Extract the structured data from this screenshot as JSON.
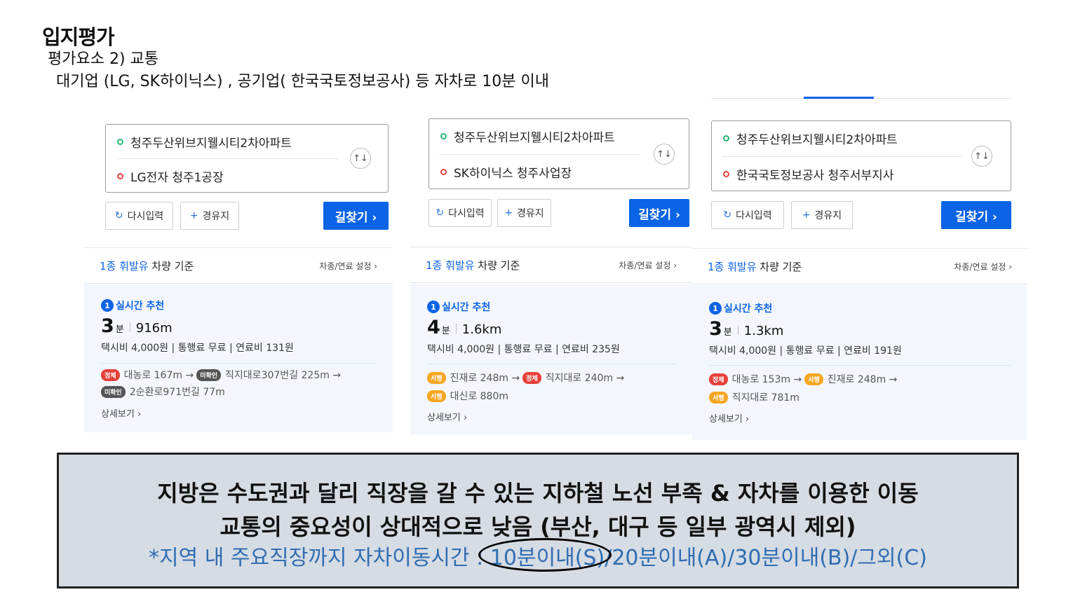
{
  "header": {
    "title": "입지평가",
    "subtitle": "평가요소 2) 교통",
    "summary": "대기업 (LG, SK하이닉스) , 공기업( 한국국토정보공사) 등 자차로 10분 이내"
  },
  "panels": [
    {
      "origin": "청주두산위브지웰시티2차아파트",
      "destination": "LG전자 청주1공장",
      "swap_icon": "↑↓",
      "reset_label": "다시입력",
      "waypoint_label": "경유지",
      "search_label": "길찾기 ›",
      "basis_prefix": "1종 휘발유",
      "basis_suffix": " 차량 기준",
      "settings_label": "차종/연료 설정 ›",
      "rec_num": "1",
      "rec_label": "실시간 추천",
      "time_value": "3",
      "time_unit": "분",
      "distance": "916m",
      "costs": "택시비 4,000원  |  통행료 무료  |  연료비 131원",
      "seg1": [
        {
          "tag": "정체",
          "color": "red",
          "text": "대농로 167m →"
        },
        {
          "tag": "미확인",
          "color": "dark",
          "text": "직지대로307번길 225m →"
        }
      ],
      "seg2": [
        {
          "tag": "미확인",
          "color": "dark",
          "text": "2순환로971번길 77m"
        }
      ],
      "detail_label": "상세보기 ›"
    },
    {
      "origin": "청주두산위브지웰시티2차아파트",
      "destination": "SK하이닉스 청주사업장",
      "swap_icon": "↑↓",
      "reset_label": "다시입력",
      "waypoint_label": "경유지",
      "search_label": "길찾기 ›",
      "basis_prefix": "1종 휘발유",
      "basis_suffix": " 차량 기준",
      "settings_label": "차종/연료 설정 ›",
      "rec_num": "1",
      "rec_label": "실시간 추천",
      "time_value": "4",
      "time_unit": "분",
      "distance": "1.6km",
      "costs": "택시비 4,000원  |  통행료 무료  |  연료비 235원",
      "seg1": [
        {
          "tag": "서행",
          "color": "orange",
          "text": "진재로 248m →"
        },
        {
          "tag": "정체",
          "color": "red",
          "text": "직지대로 240m →"
        }
      ],
      "seg2": [
        {
          "tag": "서행",
          "color": "orange",
          "text": "대신로 880m"
        }
      ],
      "detail_label": "상세보기 ›"
    },
    {
      "origin": "청주두산위브지웰시티2차아파트",
      "destination": "한국국토정보공사 청주서부지사",
      "swap_icon": "↑↓",
      "reset_label": "다시입력",
      "waypoint_label": "경유지",
      "search_label": "길찾기 ›",
      "basis_prefix": "1종 휘발유",
      "basis_suffix": " 차량 기준",
      "settings_label": "차종/연료 설정 ›",
      "rec_num": "1",
      "rec_label": "실시간 추천",
      "time_value": "3",
      "time_unit": "분",
      "distance": "1.3km",
      "costs": "택시비 4,000원  |  통행료 무료  |  연료비 191원",
      "seg1": [
        {
          "tag": "정체",
          "color": "red",
          "text": "대농로 153m →"
        },
        {
          "tag": "서행",
          "color": "orange",
          "text": "진재로 248m →"
        }
      ],
      "seg2": [
        {
          "tag": "서행",
          "color": "orange",
          "text": "직지대로 781m"
        }
      ],
      "detail_label": "상세보기 ›"
    }
  ],
  "caption": {
    "line1": "지방은 수도권과 달리 직장을 갈 수 있는 지하철 노선 부족 & 자차를 이용한 이동",
    "line2": "교통의 중요성이 상대적으로 낮음 (부산, 대구 등 일부 광역시 제외)",
    "line3": "*지역 내 주요직장까지 자차이동시간 : 10분이내(S)/20분이내(A)/30분이내(B)/그외(C)"
  },
  "colors": {
    "accent": "#0b63e5",
    "congested": "#e8413c",
    "slow": "#f5a623",
    "unknown": "#555555",
    "caption_bg": "#d6dce4",
    "caption_note": "#2f6db3"
  }
}
